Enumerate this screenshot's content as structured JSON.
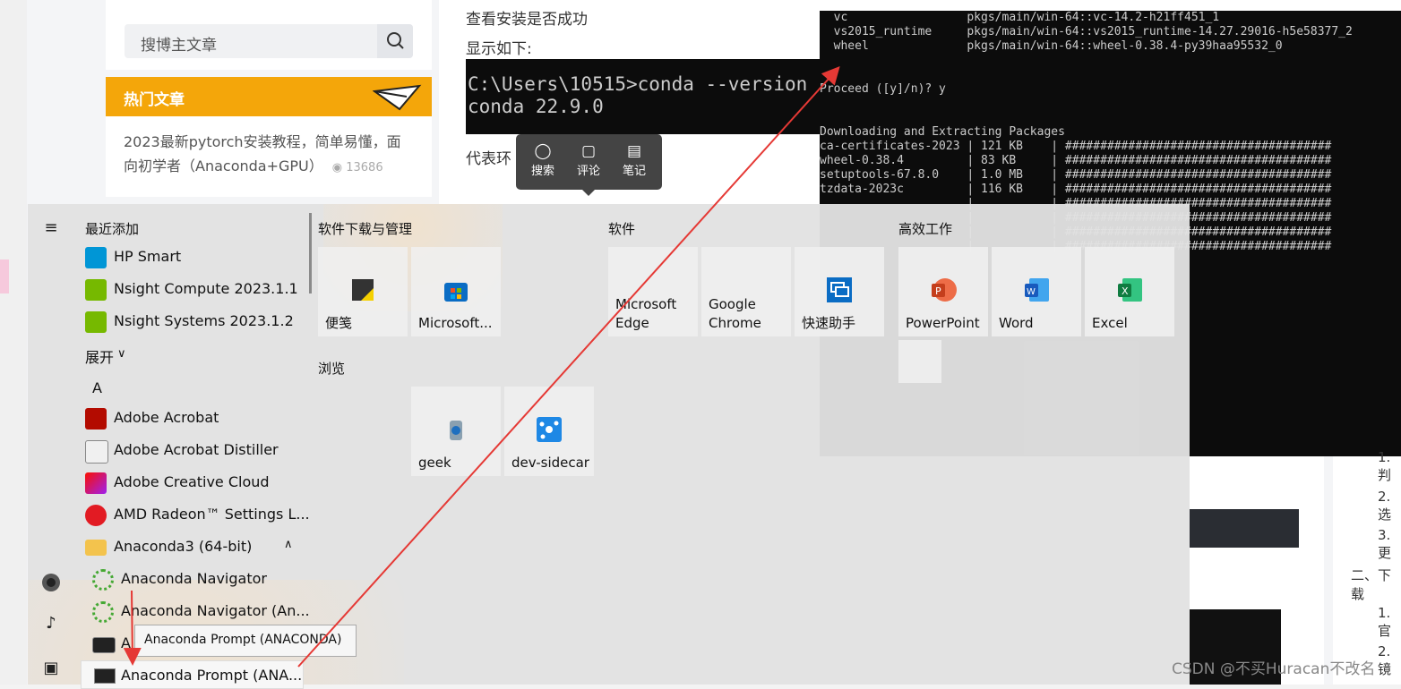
{
  "blog": {
    "search_placeholder": "搜博主文章",
    "hot_title": "热门文章",
    "hot_article": "2023最新pytorch安装教程，简单易懂，面向初学者（Anaconda+GPU）",
    "hot_views": "13686",
    "check_install": "查看安装是否成功",
    "shown_as": "显示如下:",
    "represents": "代表环",
    "cmd_line1": "C:\\Users\\10515>conda --version",
    "cmd_line2": "conda 22.9.0",
    "toolbar": [
      {
        "icon": "search-icon",
        "label": "搜索"
      },
      {
        "icon": "comment-icon",
        "label": "评论"
      },
      {
        "icon": "note-icon",
        "label": "笔记"
      }
    ],
    "right_items": [
      "1.判",
      "2.选",
      "3.更",
      "二、下载",
      "1.官",
      "2.镜"
    ],
    "watermark": "CSDN @不买Huracan不改名"
  },
  "terminal": {
    "lines": [
      "  vc                 pkgs/main/win-64::vc-14.2-h21ff451_1",
      "  vs2015_runtime     pkgs/main/win-64::vs2015_runtime-14.27.29016-h5e58377_2",
      "  wheel              pkgs/main/win-64::wheel-0.38.4-py39haa95532_0",
      "",
      "",
      "Proceed ([y]/n)? y",
      "",
      "",
      "Downloading and Extracting Packages",
      "ca-certificates-2023 | 121 KB    | ######################################",
      "wheel-0.38.4         | 83 KB     | ######################################",
      "setuptools-67.8.0    | 1.0 MB    | ######################################",
      "tzdata-2023c         | 116 KB    | ######################################",
      "                     |           | ######################################",
      "                     |           | ######################################",
      "                     |           | ######################################",
      "                     |           | ######################################"
    ]
  },
  "start_menu": {
    "recent_header": "最近添加",
    "expand_label": "展开",
    "letter_a": "A",
    "apps": [
      {
        "name": "HP Smart",
        "icon": "hp-smart-icon",
        "color": "#0096d6"
      },
      {
        "name": "Nsight Compute 2023.1.1",
        "icon": "nsight-compute-icon",
        "color": "#76b900"
      },
      {
        "name": "Nsight Systems 2023.1.2",
        "icon": "nsight-systems-icon",
        "color": "#76b900"
      },
      {
        "name": "Adobe Acrobat",
        "icon": "adobe-acrobat-icon",
        "color": "#b30b00"
      },
      {
        "name": "Adobe Acrobat Distiller",
        "icon": "acrobat-distiller-icon",
        "color": "#333333"
      },
      {
        "name": "Adobe Creative Cloud",
        "icon": "creative-cloud-icon",
        "color": "#da1f26"
      },
      {
        "name": "AMD Radeon™ Settings L...",
        "icon": "amd-radeon-icon",
        "color": "#e21b23"
      },
      {
        "name": "Anaconda3 (64-bit)",
        "icon": "folder-icon",
        "color": "#f3c34d"
      },
      {
        "name": "Anaconda Navigator",
        "icon": "anaconda-navigator-icon",
        "color": "#44a833"
      },
      {
        "name": "Anaconda Navigator (An...",
        "icon": "anaconda-navigator-icon",
        "color": "#44a833"
      },
      {
        "name": "A",
        "icon": "terminal-icon",
        "color": "#222222"
      },
      {
        "name": "Anaconda Prompt (ANA...",
        "icon": "terminal-icon",
        "color": "#222222"
      }
    ],
    "tooltip": "Anaconda Prompt (ANACONDA)",
    "groups": {
      "software_mgmt": "软件下载与管理",
      "software": "软件",
      "productivity": "高效工作",
      "browse": "浏览"
    },
    "tiles": {
      "sticky": "便笺",
      "store": "Microsoft...",
      "edge": "Microsoft Edge",
      "chrome": "Google Chrome",
      "quick_assist": "快速助手",
      "powerpoint": "PowerPoint",
      "word": "Word",
      "excel": "Excel",
      "geek": "geek",
      "dev_sidecar": "dev-sidecar"
    }
  },
  "annotation_color": "#e53935"
}
